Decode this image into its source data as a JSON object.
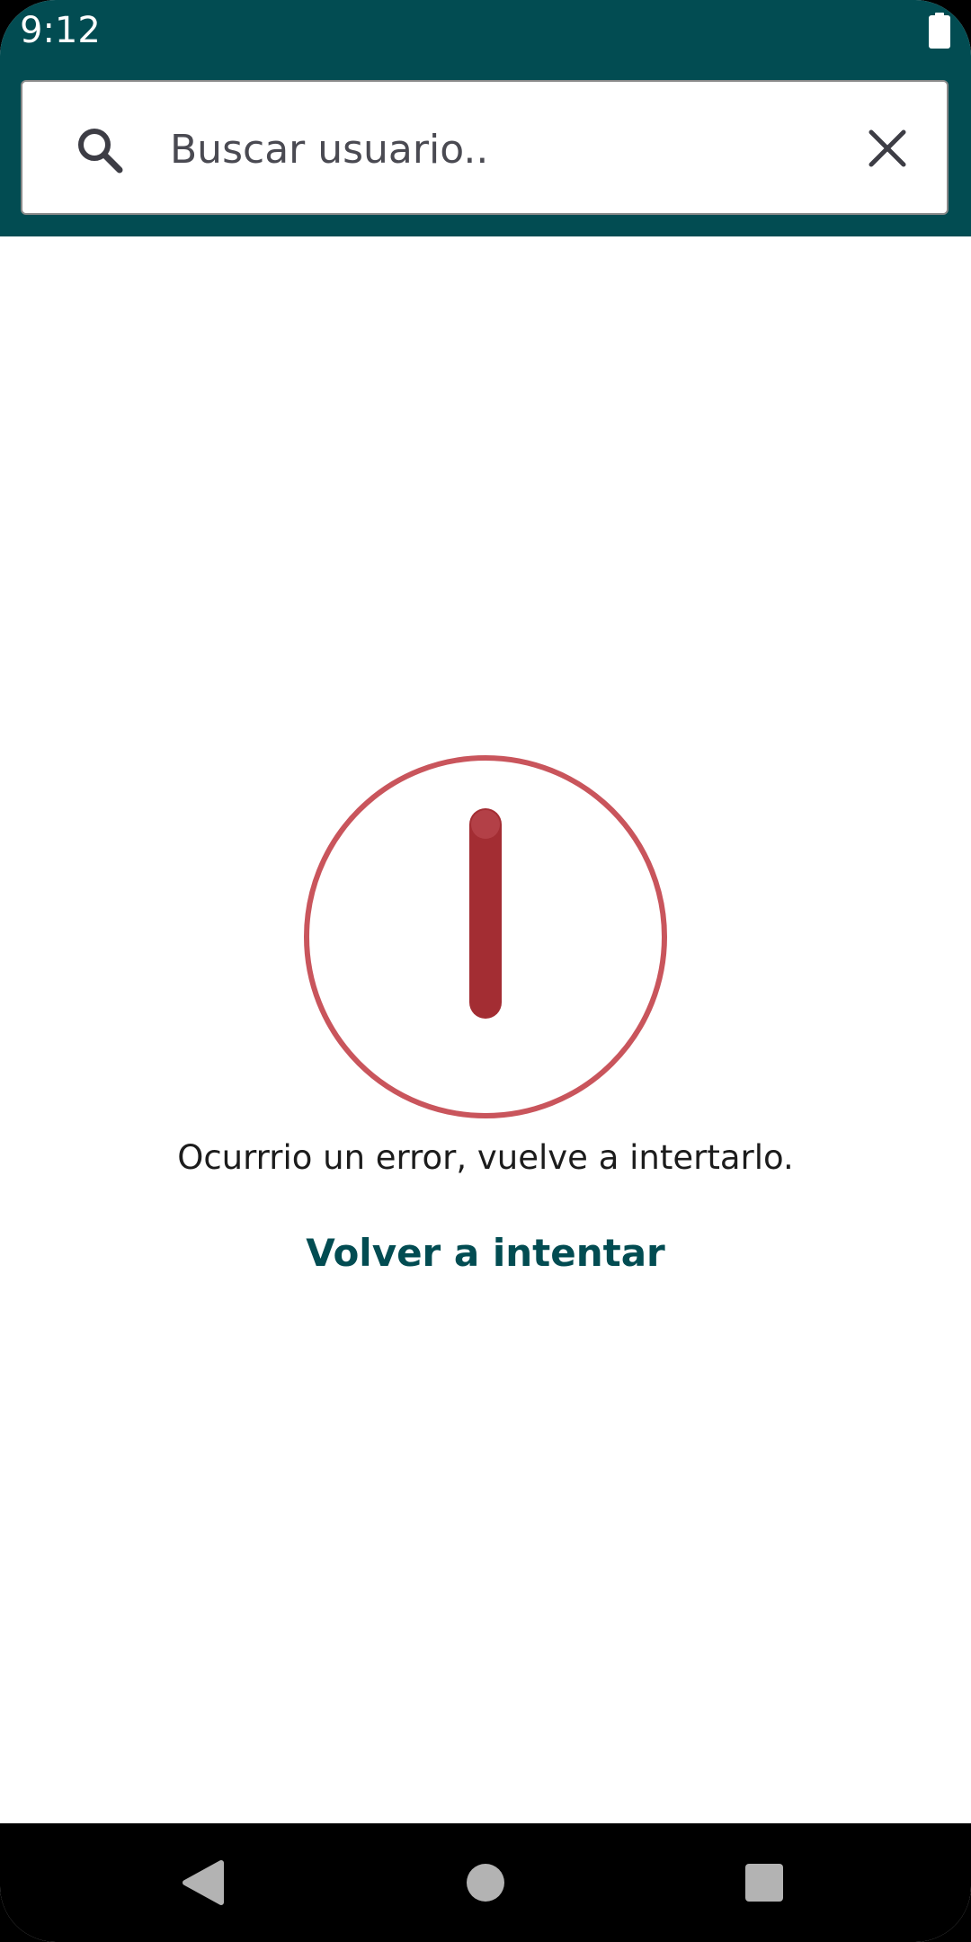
{
  "status_bar": {
    "time": "9:12"
  },
  "search": {
    "placeholder": "Buscar usuario..",
    "value": "",
    "search_icon": "search-icon",
    "clear_icon": "close-icon"
  },
  "error": {
    "icon": "error-circle-icon",
    "message": "Ocurrrio un error, vuelve a intertarlo.",
    "retry_label": "Volver a intentar"
  },
  "navigation": {
    "back_icon": "back-icon",
    "home_icon": "home-icon",
    "recents_icon": "recents-icon"
  },
  "colors": {
    "primary": "#024c52",
    "error_ring": "#c9555c",
    "error_bar": "#a32d33"
  }
}
